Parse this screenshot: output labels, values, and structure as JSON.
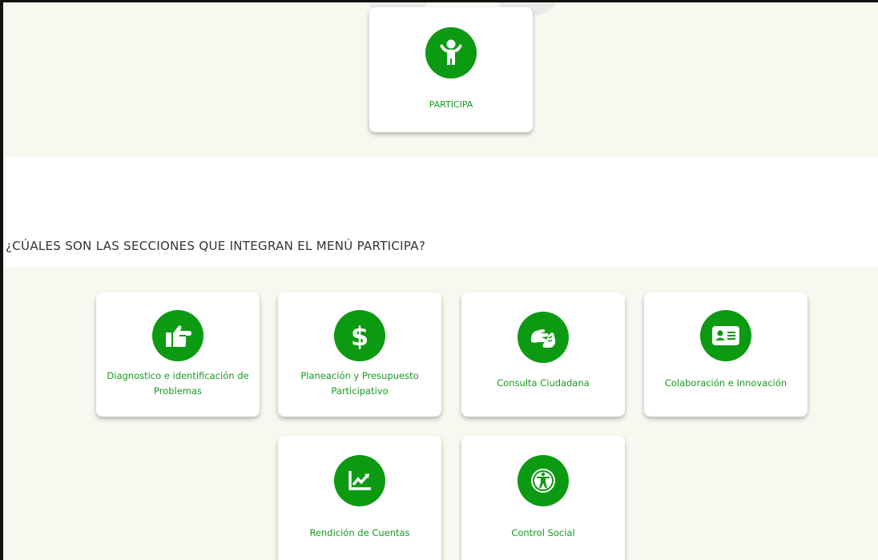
{
  "top_card": {
    "label": "PARTICIPA",
    "icon": "child-arms-up-icon"
  },
  "section_heading": "¿CÚALES SON LAS SECCIONES QUE INTEGRAN EL MENÚ PARTICIPA?",
  "sections": [
    {
      "label": "Diagnostico e identificación de Problemas",
      "icon": "pointing-hand-icon"
    },
    {
      "label": "Planeación y Presupuesto Participativo",
      "icon": "dollar-icon"
    },
    {
      "label": "Consulta Ciudadana",
      "icon": "sign-language-icon"
    },
    {
      "label": "Colaboración e Innovación",
      "icon": "id-card-icon"
    },
    {
      "label": "Rendición de Cuentas",
      "icon": "chart-line-icon"
    },
    {
      "label": "Control Social",
      "icon": "universal-access-icon"
    }
  ],
  "colors": {
    "accent": "#0b9a12",
    "label": "#169a21",
    "band": "#f7f9f1"
  }
}
